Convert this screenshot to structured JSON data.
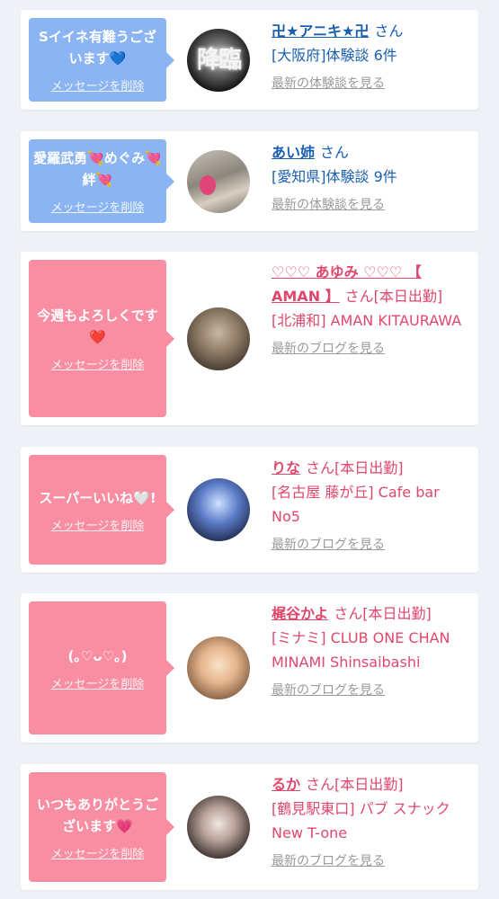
{
  "delete_label": "メッセージを削除",
  "cards": [
    {
      "message": "Sイイネ有難うございます💙",
      "name": "卍★アニキ★卍",
      "honorific": "さん",
      "meta": "[大阪府]体験談 6件",
      "link": "最新の体験談を見る",
      "avatar_text": "降臨"
    },
    {
      "message": "愛羅武勇💘めぐみ💘絆💘",
      "name": "あい姉",
      "honorific": "さん",
      "meta": "[愛知県]体験談 9件",
      "link": "最新の体験談を見る"
    },
    {
      "message": "今週もよろしくです❤️",
      "name": "♡♡♡ あゆみ ♡♡♡ 【 AMAN 】",
      "honorific": "さん[本日出勤]",
      "meta": "[北浦和] AMAN KITAURAWA",
      "link": "最新のブログを見る"
    },
    {
      "message": "スーパーいいね🤍!",
      "name": "りな",
      "honorific": "さん[本日出勤]",
      "meta": "[名古屋 藤が丘] Cafe bar No5",
      "link": "最新のブログを見る"
    },
    {
      "message": "(｡♡ᴗ♡｡)",
      "name": "梶谷かよ",
      "honorific": "さん[本日出勤]",
      "meta": "[ミナミ] CLUB ONE CHAN MINAMI Shinsaibashi",
      "link": "最新のブログを見る"
    },
    {
      "message": "いつもありがとうございます💗",
      "name": "るか",
      "honorific": "さん[本日出勤]",
      "meta": "[鶴見駅東口] パブ スナック New T-one",
      "link": "最新のブログを見る"
    }
  ]
}
